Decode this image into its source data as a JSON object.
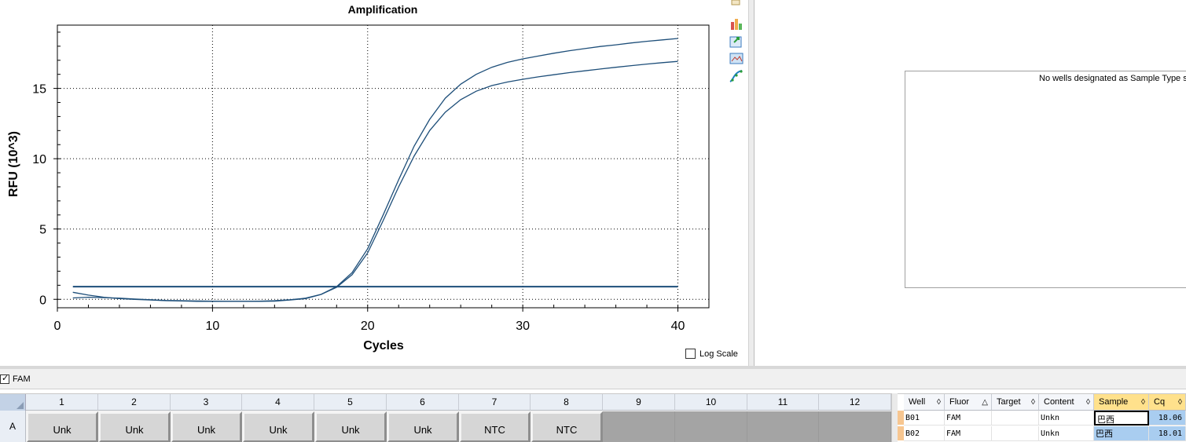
{
  "chart": {
    "title": "Amplification",
    "x_label": "Cycles",
    "y_label": "RFU (10^3)",
    "log_scale_label": "Log Scale",
    "log_scale_checked": false
  },
  "chart_data": {
    "type": "line",
    "title": "Amplification",
    "xlabel": "Cycles",
    "ylabel": "RFU (10^3)",
    "xlim": [
      0,
      42
    ],
    "ylim": [
      -0.6,
      19.5
    ],
    "x_ticks": [
      0,
      10,
      20,
      30,
      40
    ],
    "y_ticks": [
      0,
      5,
      10,
      15
    ],
    "grid": true,
    "line_color": "#1d4e79",
    "threshold": 0.9,
    "series": [
      {
        "well": "B01",
        "x": [
          1,
          2,
          3,
          4,
          5,
          6,
          7,
          8,
          9,
          10,
          11,
          12,
          13,
          14,
          15,
          16,
          17,
          18,
          19,
          20,
          21,
          22,
          23,
          24,
          25,
          26,
          27,
          28,
          29,
          30,
          31,
          32,
          33,
          34,
          35,
          36,
          37,
          38,
          39,
          40
        ],
        "values": [
          0.5,
          0.3,
          0.15,
          0.05,
          0,
          -0.05,
          -0.1,
          -0.12,
          -0.14,
          -0.15,
          -0.15,
          -0.15,
          -0.15,
          -0.13,
          -0.05,
          0.05,
          0.35,
          0.9,
          1.9,
          3.6,
          6.0,
          8.5,
          10.9,
          12.8,
          14.3,
          15.3,
          16.0,
          16.5,
          16.85,
          17.1,
          17.3,
          17.5,
          17.68,
          17.83,
          17.98,
          18.1,
          18.23,
          18.35,
          18.45,
          18.55
        ]
      },
      {
        "well": "B02",
        "x": [
          1,
          2,
          3,
          4,
          5,
          6,
          7,
          8,
          9,
          10,
          11,
          12,
          13,
          14,
          15,
          16,
          17,
          18,
          19,
          20,
          21,
          22,
          23,
          24,
          25,
          26,
          27,
          28,
          29,
          30,
          31,
          32,
          33,
          34,
          35,
          36,
          37,
          38,
          39,
          40
        ],
        "values": [
          0.1,
          0.15,
          0.12,
          0.08,
          0.02,
          -0.03,
          -0.08,
          -0.1,
          -0.12,
          -0.13,
          -0.14,
          -0.14,
          -0.13,
          -0.1,
          -0.03,
          0.08,
          0.35,
          0.85,
          1.75,
          3.3,
          5.6,
          8.0,
          10.2,
          12.0,
          13.3,
          14.2,
          14.8,
          15.2,
          15.45,
          15.65,
          15.82,
          15.97,
          16.12,
          16.25,
          16.38,
          16.5,
          16.62,
          16.73,
          16.83,
          16.92
        ]
      }
    ]
  },
  "toolbar_icons": [
    "copy-icon",
    "chart-type-icon",
    "export-icon",
    "image-icon",
    "curve-icon"
  ],
  "right_panel": {
    "message": "No wells designated as Sample Type sta"
  },
  "fluor_bar": {
    "label": "FAM",
    "checked": true
  },
  "plate": {
    "columns": [
      "1",
      "2",
      "3",
      "4",
      "5",
      "6",
      "7",
      "8",
      "9",
      "10",
      "11",
      "12"
    ],
    "row_label": "A",
    "wells": [
      "Unk",
      "Unk",
      "Unk",
      "Unk",
      "Unk",
      "Unk",
      "NTC",
      "NTC",
      "",
      "",
      "",
      ""
    ]
  },
  "well_table": {
    "headers": [
      "Well",
      "Fluor",
      "Target",
      "Content",
      "Sample",
      "Cq"
    ],
    "rows": [
      {
        "well": "B01",
        "fluor": "FAM",
        "target": "",
        "content": "Unkn",
        "sample": "巴西",
        "cq": "18.06"
      },
      {
        "well": "B02",
        "fluor": "FAM",
        "target": "",
        "content": "Unkn",
        "sample": "巴西",
        "cq": "18.01"
      }
    ]
  }
}
